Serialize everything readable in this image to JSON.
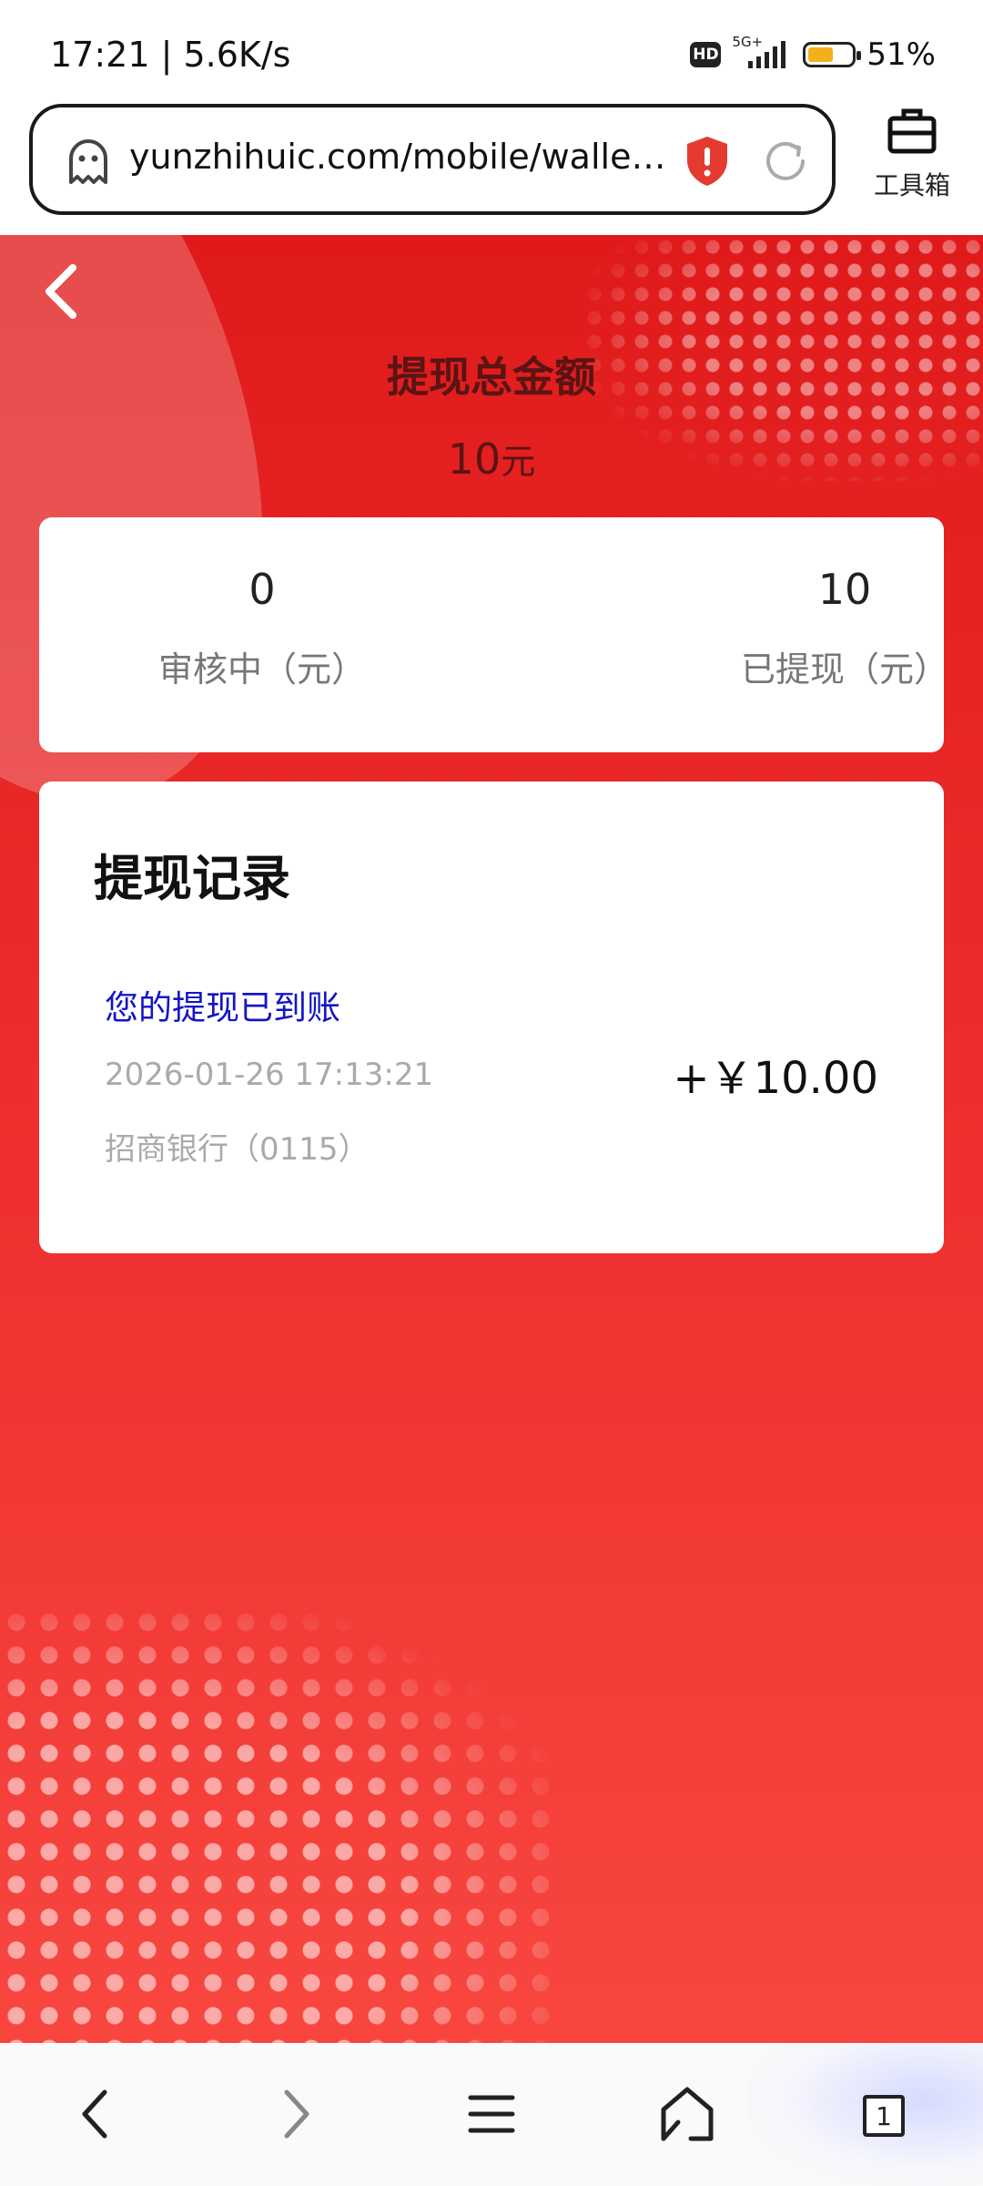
{
  "status_bar": {
    "time_speed": "17:21 | 5.6K/s",
    "hd": "HD",
    "network": "5G+",
    "battery": "51%"
  },
  "browser": {
    "url": "yunzhihuic.com/mobile/walle…",
    "toolbox_label": "工具箱",
    "tab_count": "1"
  },
  "page": {
    "title": "提现总金额",
    "total_amount": "10",
    "total_unit": "元",
    "pending_value": "0",
    "pending_label": "审核中（元）",
    "withdrawn_value": "10",
    "withdrawn_label": "已提现（元）",
    "records_title": "提现记录",
    "record": {
      "status": "您的提现已到账",
      "time": "2026-01-26 17:13:21",
      "bank": "招商银行（0115）",
      "amount": "+￥10.00"
    }
  },
  "colors": {
    "page_red": "#e01a1a",
    "record_status_blue": "#1414c8",
    "title_dark_red": "#5a1414"
  },
  "icons": [
    "ghost-icon",
    "shield-alert-icon",
    "reload-icon",
    "toolbox-icon",
    "back-arrow-icon",
    "nav-back-icon",
    "nav-forward-icon",
    "menu-icon",
    "home-icon",
    "tabs-icon"
  ]
}
